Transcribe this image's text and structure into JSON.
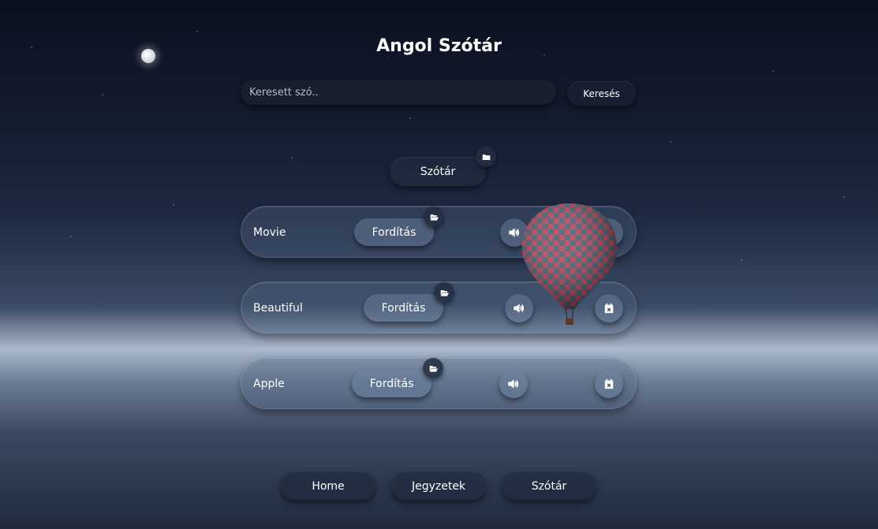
{
  "header": {
    "title": "Angol Szótár"
  },
  "search": {
    "placeholder": "Keresett szó..",
    "button_label": "Keresés"
  },
  "dictionary_button": {
    "label": "Szótár",
    "badge_icon": "folder-icon"
  },
  "words": [
    {
      "word": "Movie",
      "translate_label": "Fordítás"
    },
    {
      "word": "Beautiful",
      "translate_label": "Fordítás"
    },
    {
      "word": "Apple",
      "translate_label": "Fordítás"
    }
  ],
  "row_icons": {
    "badge": "folder-open-icon",
    "sound": "speaker-icon",
    "delete": "calendar-x-icon"
  },
  "nav": [
    {
      "label": "Home"
    },
    {
      "label": "Jegyzetek"
    },
    {
      "label": "Szótár"
    }
  ]
}
